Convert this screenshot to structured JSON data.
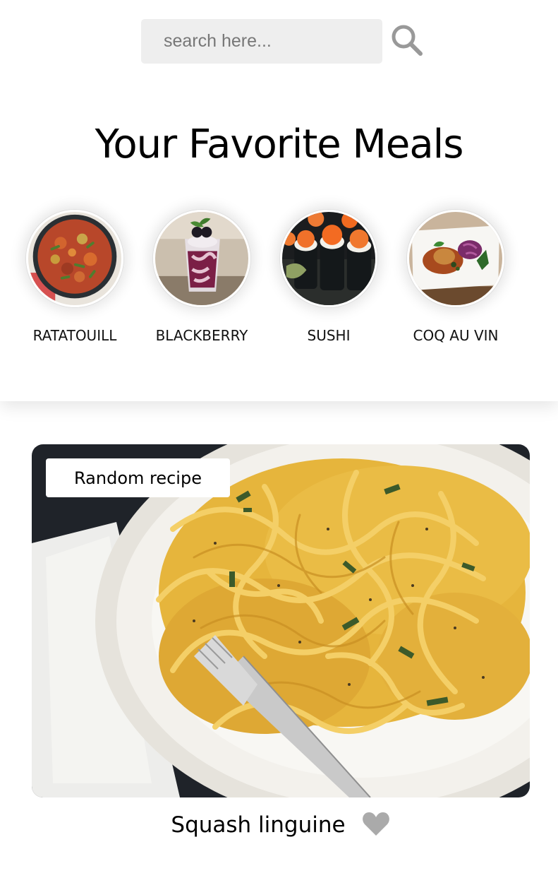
{
  "search": {
    "placeholder": "search here...",
    "value": "",
    "button_icon": "search-icon"
  },
  "favorites": {
    "title": "Your Favorite Meals",
    "items": [
      {
        "label": "RATATOUILL",
        "image": "ratatouille-photo"
      },
      {
        "label": "BLACKBERRY",
        "image": "blackberry-dessert-photo"
      },
      {
        "label": "SUSHI",
        "image": "sushi-photo"
      },
      {
        "label": "COQ AU VIN",
        "image": "coq-au-vin-photo"
      }
    ]
  },
  "recipe": {
    "tag": "Random recipe",
    "name": "Squash linguine",
    "image": "squash-linguine-photo",
    "favorite_icon": "heart-icon",
    "favorited": false
  },
  "colors": {
    "search_bg": "#eeeeee",
    "icon_gray": "#999999",
    "heart_gray": "#aaaaaa",
    "text": "#000000",
    "background": "#ffffff"
  }
}
